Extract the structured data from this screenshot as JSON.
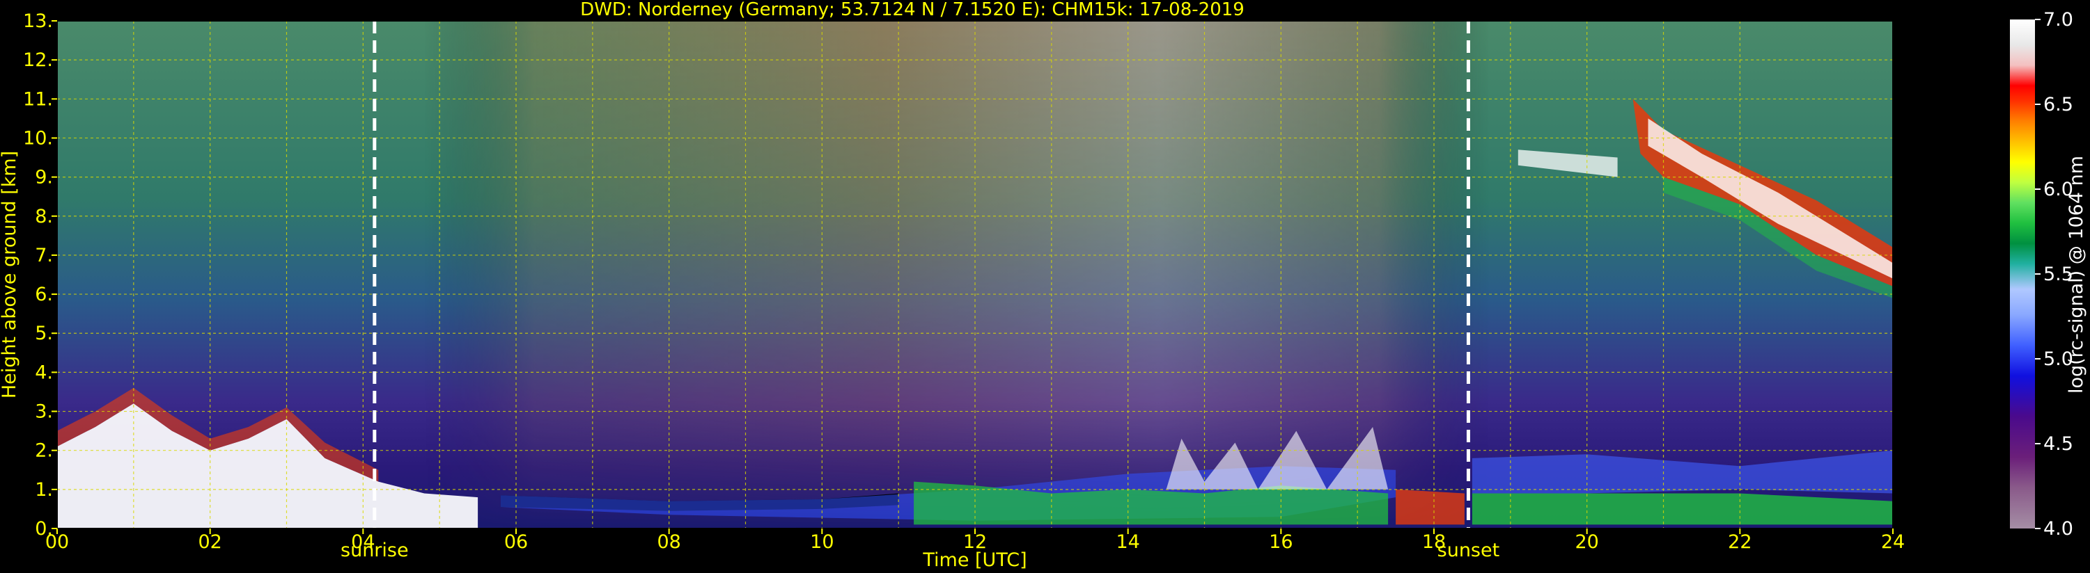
{
  "chart_data": {
    "type": "heatmap",
    "title": "DWD: Norderney (Germany; 53.7124 N / 7.1520 E):    CHM15k: 17-08-2019",
    "xlabel": "Time [UTC]",
    "ylabel": "Height above ground [km]",
    "xlim": [
      0,
      24
    ],
    "ylim": [
      0,
      13
    ],
    "x_tick_labels": [
      "00",
      "02",
      "04",
      "06",
      "08",
      "10",
      "12",
      "14",
      "16",
      "18",
      "20",
      "22",
      "24"
    ],
    "y_tick_labels": [
      "0.",
      "1.",
      "2.",
      "3.",
      "4.",
      "5.",
      "6.",
      "7.",
      "8.",
      "9.",
      "10.",
      "11.",
      "12.",
      "13."
    ],
    "grid": true,
    "colorbar": {
      "label": "log(rc-signal) @ 1064 nm",
      "range": [
        4.0,
        7.0
      ],
      "tick_labels": [
        "4.0",
        "4.5",
        "5.0",
        "5.5",
        "6.0",
        "6.5",
        "7.0"
      ],
      "colors": [
        "#a58ea5",
        "#8a5a8a",
        "#6b1f7a",
        "#4a0a8c",
        "#1010e0",
        "#4060ff",
        "#8aa8ff",
        "#b0c8ff",
        "#20b0a0",
        "#009040",
        "#20c040",
        "#60e060",
        "#c0ff40",
        "#ffff00",
        "#ffc000",
        "#ff8000",
        "#ff3000",
        "#ff0000",
        "#f4c0c0",
        "#e8e8e8",
        "#ffffff"
      ]
    },
    "annotations": [
      {
        "text": "sunrise",
        "x": 4.15
      },
      {
        "text": "sunset",
        "x": 18.45
      }
    ],
    "event_lines_x": [
      4.15,
      18.45
    ]
  },
  "colors": {
    "background": "#000000",
    "text": "#ffff00",
    "grid": "#d8d800",
    "noise_high": "#3f7f6a",
    "noise_low": "#20207a",
    "boundary_layer": "#ffffff"
  }
}
